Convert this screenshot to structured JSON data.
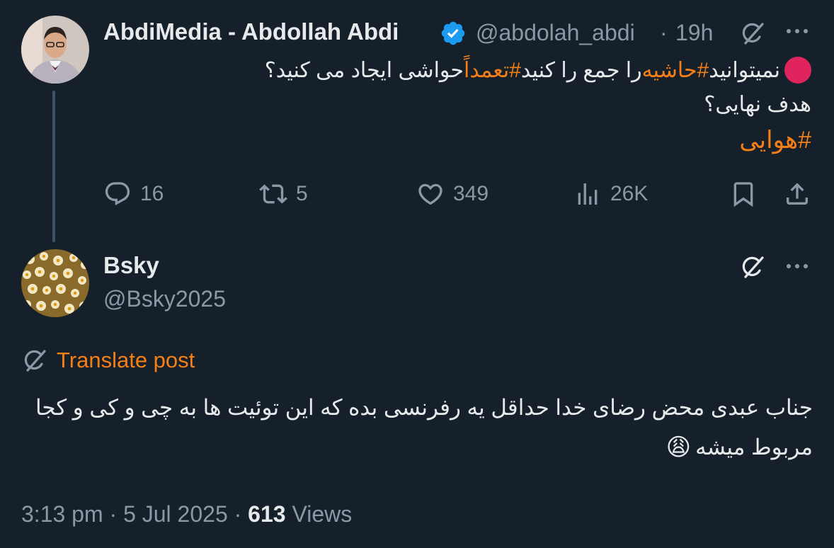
{
  "original_post": {
    "author_name": "AbdiMedia - Abdollah Abdi",
    "handle": "@abdolah_abdi",
    "separator": "·",
    "time": "19h",
    "line1_prefix": "نمیتوانید ",
    "line1_tag1": "#حاشیه",
    "line1_mid": " را جمع را کنید ",
    "line1_tag2": "#تعمداً",
    "line1_suffix": " حواشی  ایجاد می کنید؟",
    "line2": "هدف نهایی؟",
    "line3_tag": "#هوایی",
    "stats": {
      "replies": "16",
      "reposts": "5",
      "likes": "349",
      "views": "26K"
    }
  },
  "reply": {
    "author_name": "Bsky",
    "handle": "@Bsky2025",
    "translate_label": "Translate post",
    "line1": "جناب عبدی محض رضای خدا حداقل یه رفرنسی بده که این توئیت ها به چی و کی و کجا",
    "line2": "مربوط میشه",
    "emoji": "😩",
    "time": "3:13 pm",
    "separator": "·",
    "date": "5 Jul 2025",
    "views_count": "613",
    "views_label": "Views"
  },
  "icons": {
    "verified": "verified-badge-icon",
    "grok": "grok-icon",
    "more": "more-icon",
    "reply": "reply-icon",
    "repost": "repost-icon",
    "like": "like-icon",
    "views": "views-icon",
    "bookmark": "bookmark-icon",
    "share": "share-icon",
    "red_circle": "red-circle-icon"
  },
  "colors": {
    "background": "#15202b",
    "text": "#e7e9ea",
    "muted": "#8b98a5",
    "accent": "#f57f17",
    "verified": "#1d9bf0"
  }
}
